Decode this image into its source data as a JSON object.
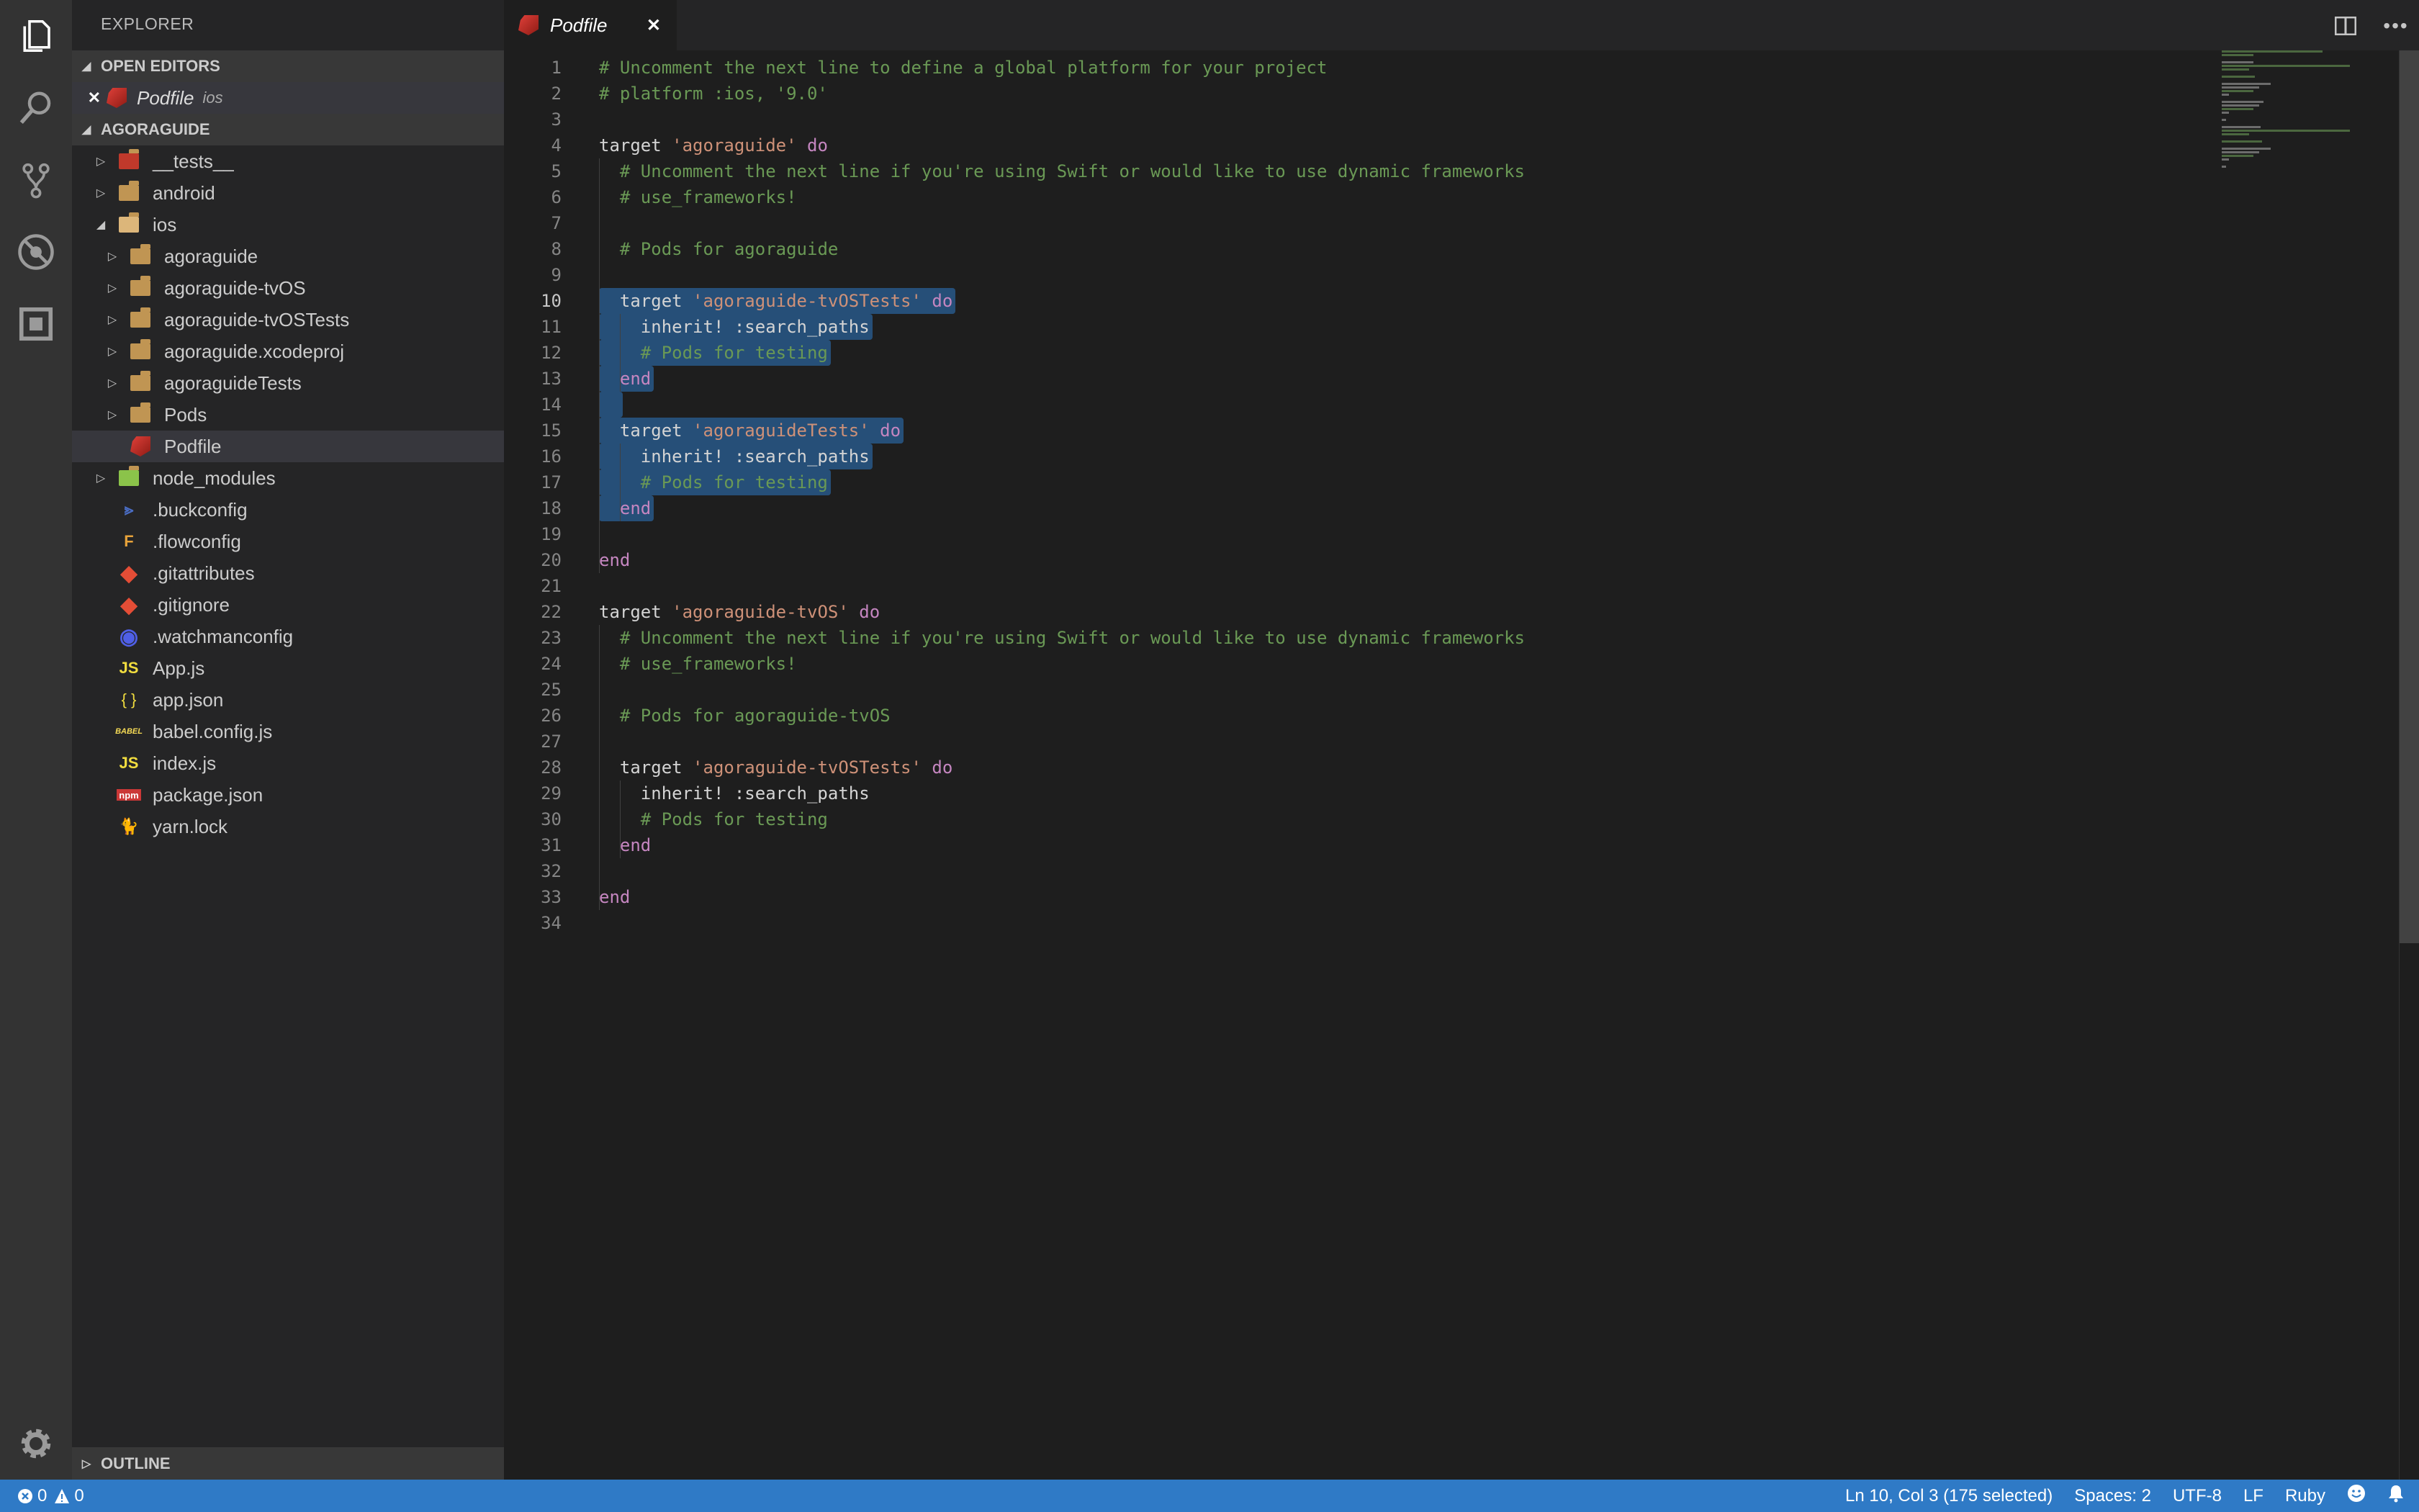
{
  "activity_bar": {
    "items": [
      {
        "name": "explorer-icon"
      },
      {
        "name": "search-icon"
      },
      {
        "name": "source-control-icon"
      },
      {
        "name": "debug-icon"
      },
      {
        "name": "extensions-icon"
      }
    ],
    "bottom": [
      {
        "name": "gear-icon"
      }
    ]
  },
  "sidebar": {
    "title": "EXPLORER",
    "open_editors": {
      "header": "OPEN EDITORS",
      "items": [
        {
          "close": "✕",
          "name": "Podfile",
          "folder": "ios"
        }
      ]
    },
    "project": {
      "header": "AGORAGUIDE",
      "tree": [
        {
          "label": "__tests__",
          "type": "folder-tests",
          "depth": 0,
          "expanded": false
        },
        {
          "label": "android",
          "type": "folder",
          "depth": 0,
          "expanded": false
        },
        {
          "label": "ios",
          "type": "folder",
          "depth": 0,
          "expanded": true
        },
        {
          "label": "agoraguide",
          "type": "folder",
          "depth": 1,
          "expanded": false
        },
        {
          "label": "agoraguide-tvOS",
          "type": "folder",
          "depth": 1,
          "expanded": false
        },
        {
          "label": "agoraguide-tvOSTests",
          "type": "folder",
          "depth": 1,
          "expanded": false
        },
        {
          "label": "agoraguide.xcodeproj",
          "type": "folder",
          "depth": 1,
          "expanded": false
        },
        {
          "label": "agoraguideTests",
          "type": "folder",
          "depth": 1,
          "expanded": false
        },
        {
          "label": "Pods",
          "type": "folder",
          "depth": 1,
          "expanded": false
        },
        {
          "label": "Podfile",
          "type": "ruby",
          "depth": 1,
          "selected": true
        },
        {
          "label": "node_modules",
          "type": "folder-node",
          "depth": 0,
          "expanded": false
        },
        {
          "label": ".buckconfig",
          "type": "buck",
          "depth": 0
        },
        {
          "label": ".flowconfig",
          "type": "flow",
          "depth": 0
        },
        {
          "label": ".gitattributes",
          "type": "git",
          "depth": 0
        },
        {
          "label": ".gitignore",
          "type": "git",
          "depth": 0
        },
        {
          "label": ".watchmanconfig",
          "type": "watchman",
          "depth": 0
        },
        {
          "label": "App.js",
          "type": "js",
          "depth": 0
        },
        {
          "label": "app.json",
          "type": "json",
          "depth": 0
        },
        {
          "label": "babel.config.js",
          "type": "babel",
          "depth": 0
        },
        {
          "label": "index.js",
          "type": "js",
          "depth": 0
        },
        {
          "label": "package.json",
          "type": "npm",
          "depth": 0
        },
        {
          "label": "yarn.lock",
          "type": "yarn",
          "depth": 0
        }
      ]
    },
    "outline": {
      "header": "OUTLINE"
    }
  },
  "tabs": [
    {
      "label": "Podfile",
      "close": "✕",
      "active": true
    }
  ],
  "editor": {
    "active_line": 10,
    "lines": [
      [
        [
          "c",
          "# Uncomment the next line to define a global platform for your project"
        ]
      ],
      [
        [
          "c",
          "# platform :ios, '9.0'"
        ]
      ],
      [],
      [
        [
          "p",
          "target "
        ],
        [
          "s",
          "'agoraguide'"
        ],
        [
          "p",
          " "
        ],
        [
          "k",
          "do"
        ]
      ],
      [
        [
          "p",
          "  "
        ],
        [
          "c",
          "# Uncomment the next line if you're using Swift or would like to use dynamic frameworks"
        ]
      ],
      [
        [
          "p",
          "  "
        ],
        [
          "c",
          "# use_frameworks!"
        ]
      ],
      [],
      [
        [
          "p",
          "  "
        ],
        [
          "c",
          "# Pods for agoraguide"
        ]
      ],
      [],
      [
        [
          "p",
          "  target "
        ],
        [
          "s",
          "'agoraguide-tvOSTests'"
        ],
        [
          "p",
          " "
        ],
        [
          "k",
          "do"
        ]
      ],
      [
        [
          "p",
          "    inherit! :search_paths"
        ]
      ],
      [
        [
          "p",
          "    "
        ],
        [
          "c",
          "# Pods for testing"
        ]
      ],
      [
        [
          "p",
          "  "
        ],
        [
          "k",
          "end"
        ]
      ],
      [],
      [
        [
          "p",
          "  target "
        ],
        [
          "s",
          "'agoraguideTests'"
        ],
        [
          "p",
          " "
        ],
        [
          "k",
          "do"
        ]
      ],
      [
        [
          "p",
          "    inherit! :search_paths"
        ]
      ],
      [
        [
          "p",
          "    "
        ],
        [
          "c",
          "# Pods for testing"
        ]
      ],
      [
        [
          "p",
          "  "
        ],
        [
          "k",
          "end"
        ]
      ],
      [],
      [
        [
          "k",
          "end"
        ]
      ],
      [],
      [
        [
          "p",
          "target "
        ],
        [
          "s",
          "'agoraguide-tvOS'"
        ],
        [
          "p",
          " "
        ],
        [
          "k",
          "do"
        ]
      ],
      [
        [
          "p",
          "  "
        ],
        [
          "c",
          "# Uncomment the next line if you're using Swift or would like to use dynamic frameworks"
        ]
      ],
      [
        [
          "p",
          "  "
        ],
        [
          "c",
          "# use_frameworks!"
        ]
      ],
      [],
      [
        [
          "p",
          "  "
        ],
        [
          "c",
          "# Pods for agoraguide-tvOS"
        ]
      ],
      [],
      [
        [
          "p",
          "  target "
        ],
        [
          "s",
          "'agoraguide-tvOSTests'"
        ],
        [
          "p",
          " "
        ],
        [
          "k",
          "do"
        ]
      ],
      [
        [
          "p",
          "    inherit! :search_paths"
        ]
      ],
      [
        [
          "p",
          "    "
        ],
        [
          "c",
          "# Pods for testing"
        ]
      ],
      [
        [
          "p",
          "  "
        ],
        [
          "k",
          "end"
        ]
      ],
      [],
      [
        [
          "k",
          "end"
        ]
      ],
      []
    ],
    "selection": {
      "from_line": 10,
      "to_line": 18
    }
  },
  "statusbar": {
    "errors": "0",
    "warnings": "0",
    "position": "Ln 10, Col 3 (175 selected)",
    "indent": "Spaces: 2",
    "encoding": "UTF-8",
    "eol": "LF",
    "language": "Ruby"
  },
  "colors": {
    "statusbar": "#2f7ac6",
    "selection": "#264f78",
    "comment": "#6a9955",
    "string": "#ce9178",
    "keyword": "#c586c0"
  }
}
